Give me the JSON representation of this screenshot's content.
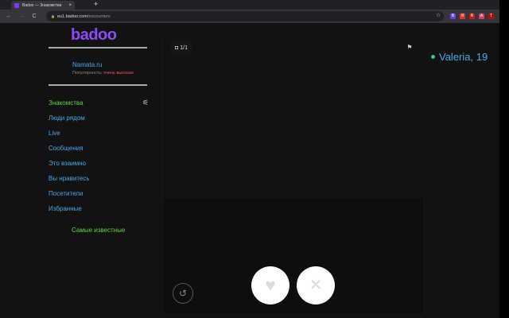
{
  "browser": {
    "tab_title": "Badoo — Знакомства",
    "close": "×",
    "new_tab": "+",
    "url_host": "eu1.badoo.com",
    "url_path": "/encounters",
    "back": "←",
    "forward": "→",
    "reload": "C",
    "lock": "🔒",
    "star": "☆",
    "extensions": [
      {
        "label": "B",
        "color": "#6b3cf0"
      },
      {
        "label": "Я",
        "color": "#e03030"
      },
      {
        "label": "R",
        "color": "#c02020"
      },
      {
        "label": "A",
        "color": "#d04060"
      },
      {
        "label": "T",
        "color": "#b01010"
      }
    ]
  },
  "sidebar": {
    "logo": "badoo",
    "user_name": "Namata.ru",
    "popularity_label": "Популярность:",
    "popularity_value": "очень высокая",
    "menu": [
      {
        "label": "Знакомства"
      },
      {
        "label": "Люди рядом"
      },
      {
        "label": "Live"
      },
      {
        "label": "Сообщения"
      },
      {
        "label": "Это взаимно"
      },
      {
        "label": "Вы нравитесь"
      },
      {
        "label": "Посетители"
      },
      {
        "label": "Избранные"
      }
    ],
    "filter_icon": "⚟",
    "famous": "Самые известные"
  },
  "card": {
    "photo_count": "1/1",
    "camera_icon": "◘",
    "flag_icon": "⚑",
    "name": "Valeria, 19",
    "undo_icon": "↺",
    "like_icon": "♥",
    "dislike_icon": "✕"
  }
}
